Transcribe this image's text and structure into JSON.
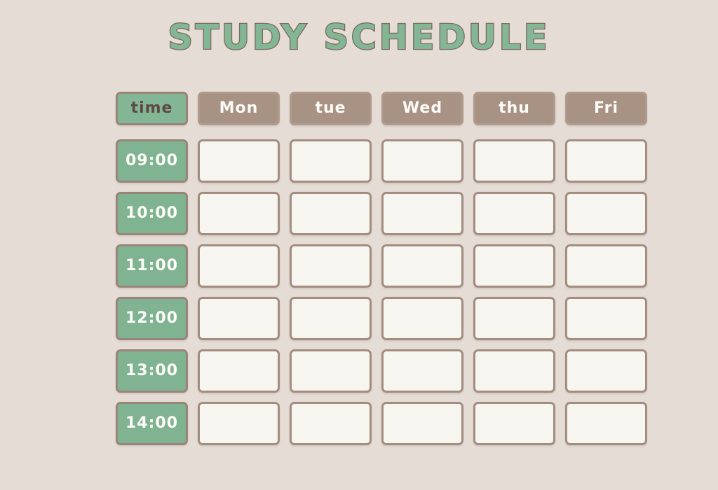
{
  "page": {
    "title": "STUDY SCHEDULE",
    "background_color": "#e5dcd6",
    "title_color": "#83b694",
    "title_outline_color": "#7d6a5e"
  },
  "table": {
    "time_header": "time",
    "time_header_bg": "#83b694",
    "day_header_bg": "#a89283",
    "time_cell_bg": "#7fb391",
    "slot_cell_bg": "#f7f5ef",
    "border_color": "#9a8478",
    "days": [
      "Mon",
      "tue",
      "Wed",
      "thu",
      "Fri"
    ],
    "times": [
      "09:00",
      "10:00",
      "11:00",
      "12:00",
      "13:00",
      "14:00"
    ],
    "entries": [
      [
        "",
        "",
        "",
        "",
        ""
      ],
      [
        "",
        "",
        "",
        "",
        ""
      ],
      [
        "",
        "",
        "",
        "",
        ""
      ],
      [
        "",
        "",
        "",
        "",
        ""
      ],
      [
        "",
        "",
        "",
        "",
        ""
      ],
      [
        "",
        "",
        "",
        "",
        ""
      ]
    ]
  }
}
